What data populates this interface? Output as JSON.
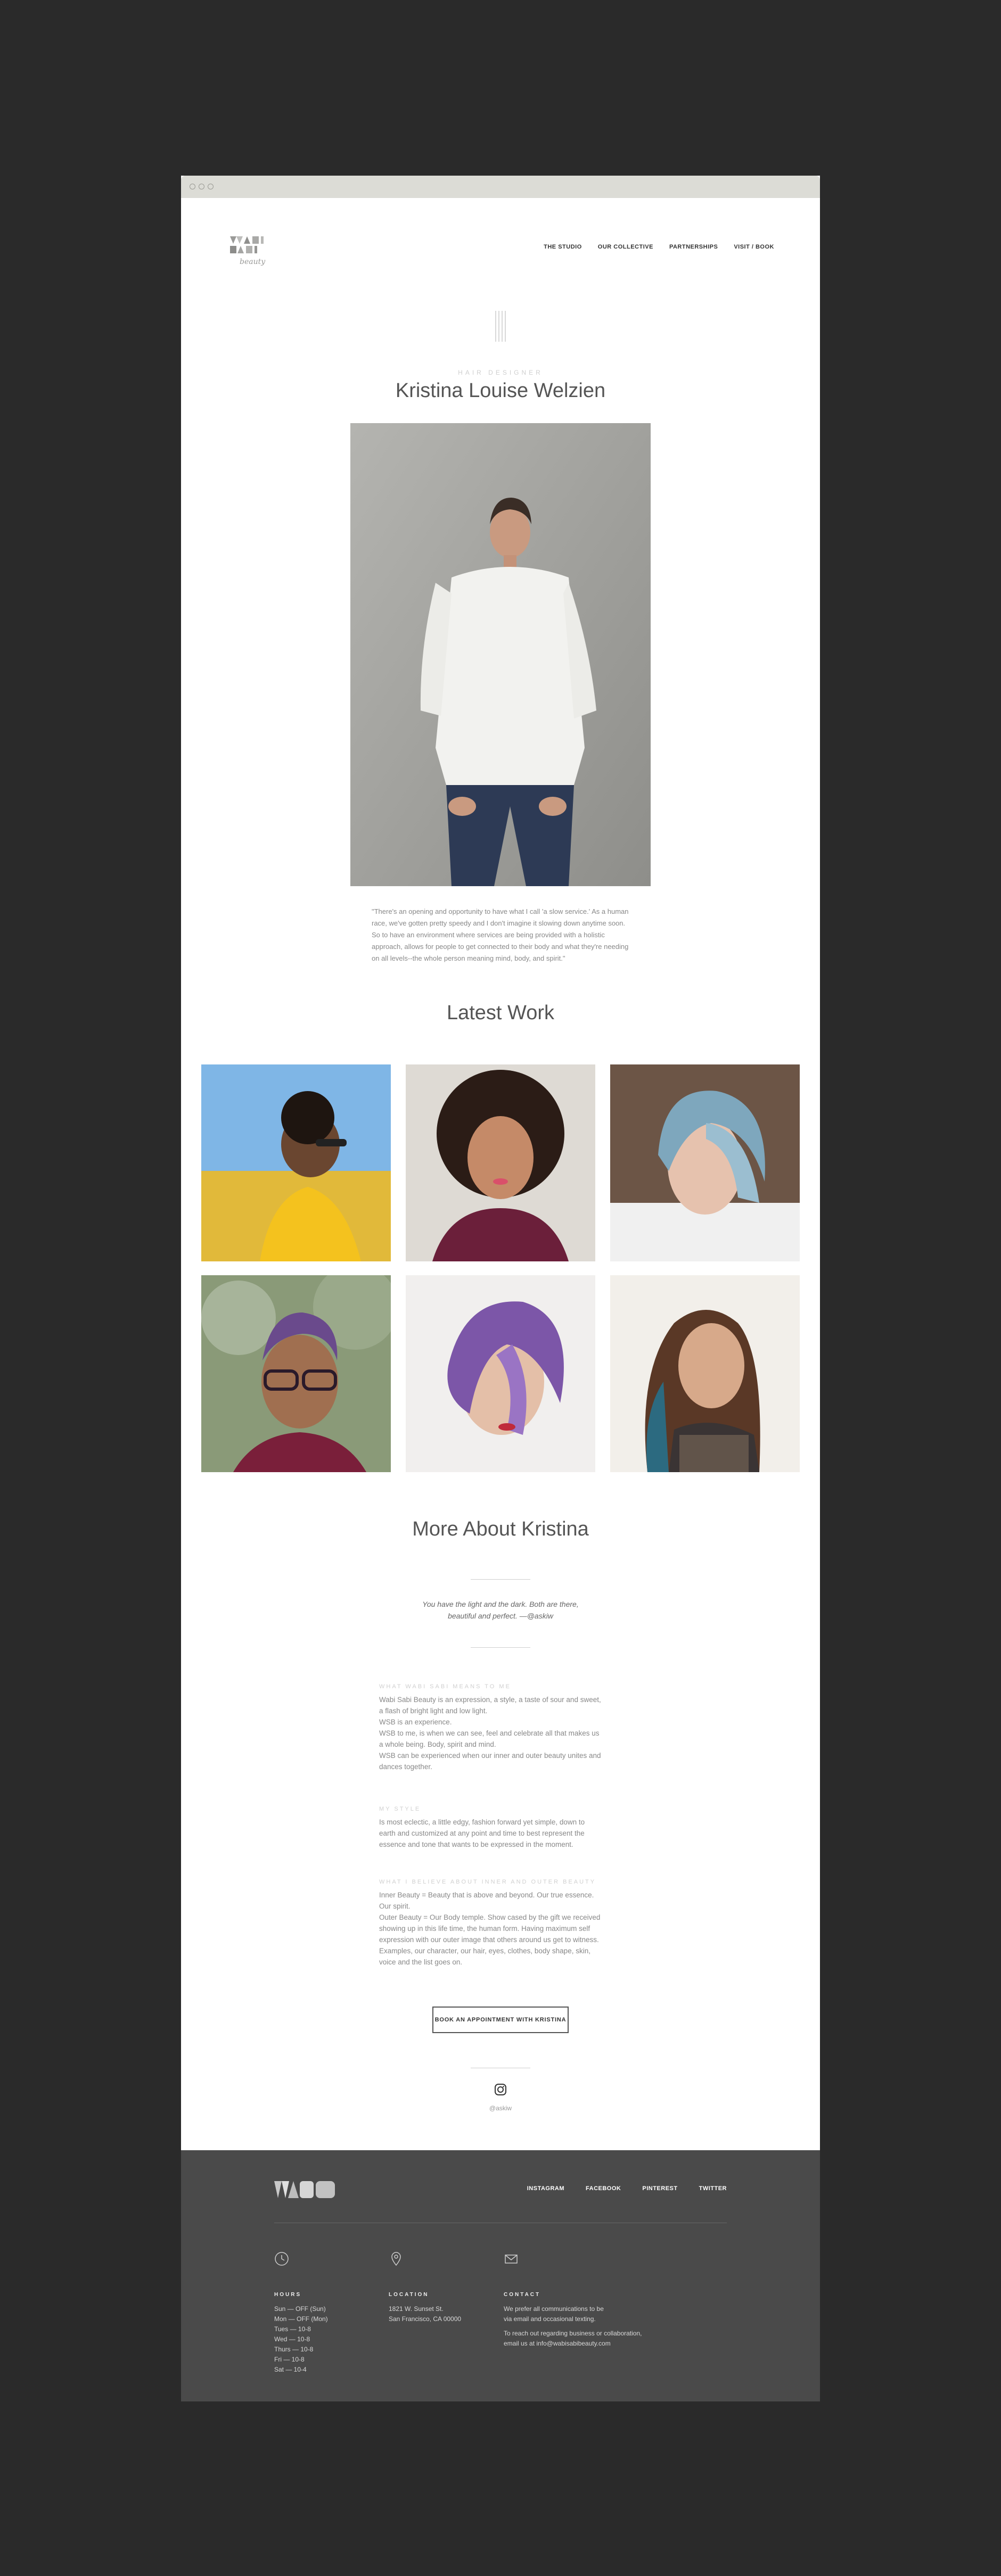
{
  "nav": {
    "logo_text": "WABI SABI",
    "logo_script": "beauty",
    "links": [
      "THE STUDIO",
      "OUR COLLECTIVE",
      "PARTNERSHIPS",
      "VISIT / BOOK"
    ]
  },
  "profile": {
    "role": "Hair Designer",
    "name": "Kristina Louise Welzien",
    "quote": "\"There's an opening and opportunity to have what I call 'a slow service.' As a human race, we've gotten pretty speedy and I don't imagine it slowing down anytime soon. So to have an environment where services are being provided with a holistic approach, allows for people to get connected to their body and what they're needing on all levels--the whole person meaning mind, body, and spirit.\""
  },
  "latest_work": {
    "title": "Latest Work"
  },
  "more_about": {
    "title": "More About Kristina",
    "epigraph_line1": "You have the light and the dark. Both are there,",
    "epigraph_line2": "beautiful and perfect. —@askiw",
    "sections": [
      {
        "heading": "What Wabi Sabi Means To Me",
        "lines": [
          "Wabi Sabi Beauty is an expression, a style, a taste of sour and sweet, a flash of bright light and low light.",
          "WSB is an experience.",
          "WSB to me, is when we can see, feel and celebrate all that makes us a whole being. Body, spirit and mind.",
          "WSB can be experienced when our inner and outer beauty unites and dances together."
        ]
      },
      {
        "heading": "My Style",
        "lines": [
          "Is most eclectic, a little edgy, fashion forward yet simple, down to earth and customized at any point and time to best represent the essence and tone that wants to be expressed in the moment."
        ]
      },
      {
        "heading": "What I Believe About Inner And Outer Beauty",
        "lines": [
          "Inner Beauty = Beauty that is above and beyond. Our true essence. Our spirit.",
          "Outer Beauty = Our Body temple. Show cased by the gift we received showing up in this life time, the human form. Having maximum self expression with our outer image that others around us get to witness. Examples, our character, our hair, eyes, clothes, body shape, skin, voice and the list goes on."
        ]
      }
    ],
    "book_button": "BOOK AN APPOINTMENT WITH KRISTINA",
    "instagram_handle": "@askiw"
  },
  "footer": {
    "logo_text": "WSB",
    "links": [
      "INSTAGRAM",
      "FACEBOOK",
      "PINTEREST",
      "TWITTER"
    ],
    "hours": {
      "heading": "Hours",
      "lines": [
        "Sun — OFF (Sun)",
        "Mon — OFF (Mon)",
        "Tues — 10-8",
        "Wed — 10-8",
        "Thurs — 10-8",
        "Fri — 10-8",
        "Sat — 10-4"
      ]
    },
    "location": {
      "heading": "Location",
      "lines": [
        "1821 W. Sunset St.",
        "San Francisco, CA 00000"
      ]
    },
    "contact": {
      "heading": "Contact",
      "lines": [
        "We prefer all communications to be",
        "via email and occasional texting.",
        "",
        "To reach out regarding business or collaboration,",
        "email us at info@wabisabibeauty.com"
      ]
    }
  },
  "colors": {
    "page_bg": "#2a2a2a",
    "footer_bg": "#4a4a4a",
    "accent_text": "#555555"
  }
}
